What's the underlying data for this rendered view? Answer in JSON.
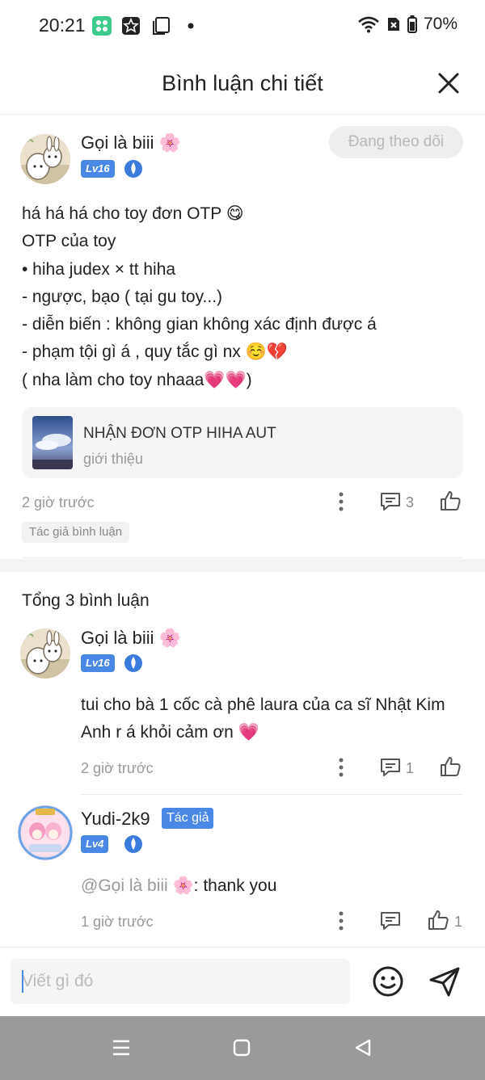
{
  "status_bar": {
    "time": "20:21",
    "battery": "70%"
  },
  "header": {
    "title": "Bình luận chi tiết"
  },
  "post": {
    "username": "Gọi là biii 🌸",
    "level": "Lv16",
    "follow_label": "Đang theo dõi",
    "body_lines": [
      "há há há cho toy đơn OTP 😋",
      "OTP của toy",
      "•   hiha judex × tt hiha",
      "- ngược, bạo ( tại gu toy...)",
      "- diễn biến : không gian không xác định được á",
      "- phạm tội gì á , quy tắc gì nx ☺️💔",
      "( nha làm cho toy nhaaa💗💗)"
    ],
    "link_card": {
      "title": "NHẬN ĐƠN OTP HIHA AUT",
      "subtitle": "giới thiệu"
    },
    "time": "2 giờ trước",
    "comment_count": "3",
    "author_tag": "Tác giả bình luận"
  },
  "total_label": "Tổng 3 bình luận",
  "comments": [
    {
      "username": "Gọi là biii 🌸",
      "level": "Lv16",
      "text": "tui cho bà 1 cốc cà phê laura của ca sĩ Nhật Kim Anh r á khỏi cảm ơn 💗",
      "time": "2 giờ trước",
      "reply_count": "1"
    },
    {
      "username": "Yudi-2k9",
      "author_badge": "Tác giả",
      "level": "Lv4",
      "mention": "@Gọi là biii 🌸",
      "text": ": thank you",
      "time": "1 giờ trước",
      "like_count": "1"
    }
  ],
  "input": {
    "placeholder": "Viết gì đó"
  },
  "colors": {
    "accent": "#4a88e6",
    "muted": "#999999",
    "nav_bar": "#9a9a9a"
  },
  "icons": [
    "close-icon",
    "more-icon",
    "comment-icon",
    "like-icon",
    "emoji-icon",
    "send-icon",
    "menu-icon",
    "home-icon",
    "back-icon"
  ]
}
